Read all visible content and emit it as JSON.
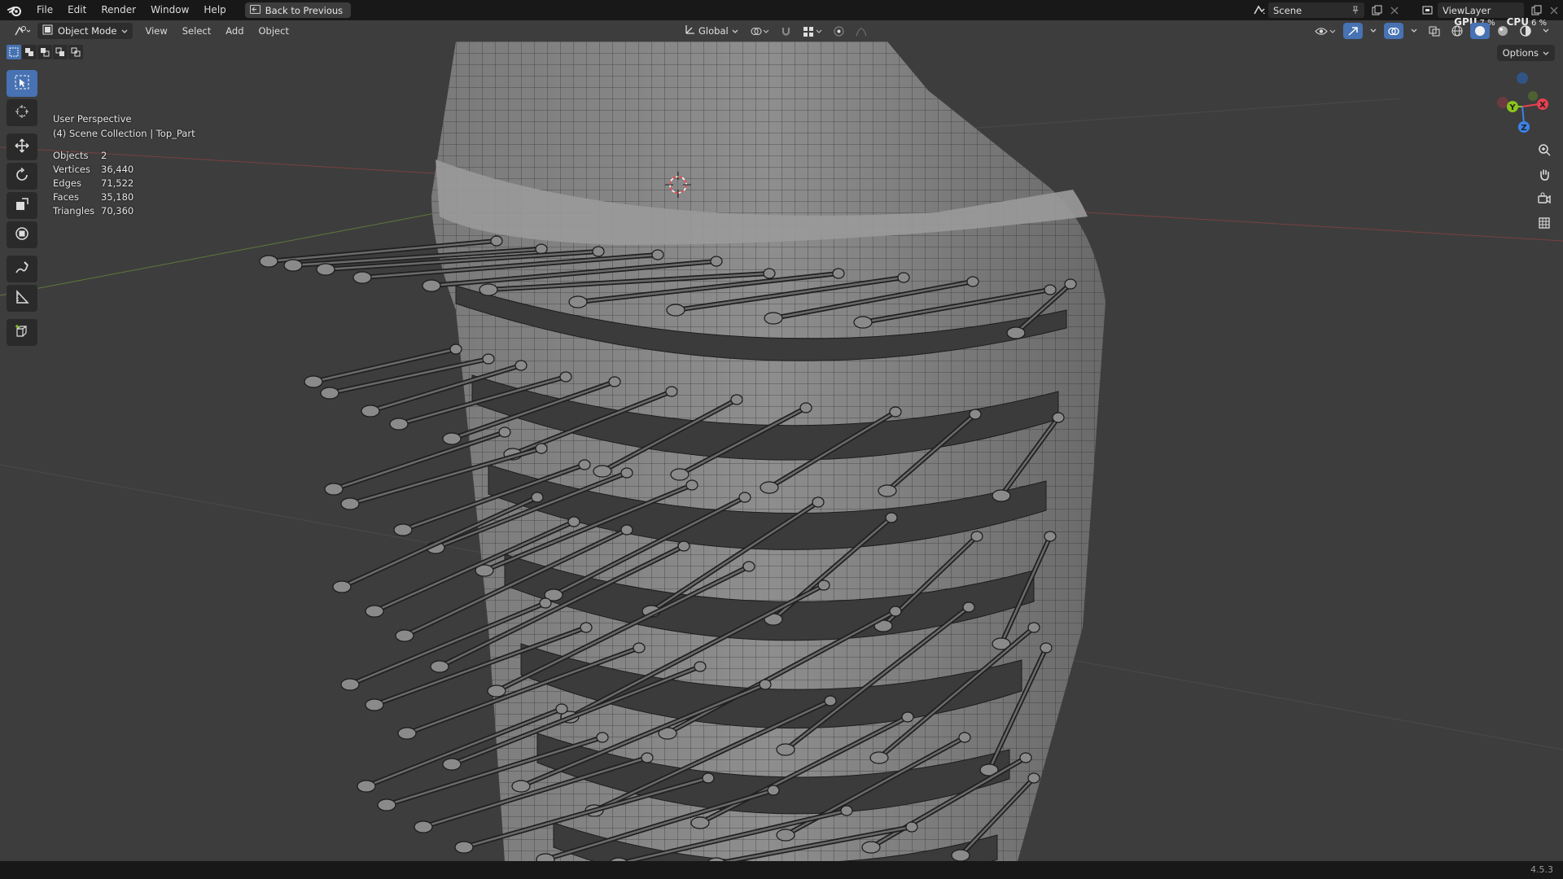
{
  "menu": {
    "items": [
      "File",
      "Edit",
      "Render",
      "Window",
      "Help"
    ],
    "back_button": "Back to Previous"
  },
  "topbar_right": {
    "scene": "Scene",
    "view_layer": "ViewLayer",
    "gpu_label": "GPU",
    "gpu_value": "7 %",
    "cpu_label": "CPU",
    "cpu_value": "6 %"
  },
  "viewport_header": {
    "mode": "Object Mode",
    "menus": [
      "View",
      "Select",
      "Add",
      "Object"
    ],
    "orientation": "Global"
  },
  "options_label": "Options",
  "overlay": {
    "perspective": "User Perspective",
    "collection": "(4) Scene Collection | Top_Part",
    "stats": [
      {
        "label": "Objects",
        "value": "2"
      },
      {
        "label": "Vertices",
        "value": "36,440"
      },
      {
        "label": "Edges",
        "value": "71,522"
      },
      {
        "label": "Faces",
        "value": "35,180"
      },
      {
        "label": "Triangles",
        "value": "70,360"
      }
    ]
  },
  "gizmo": {
    "x": "X",
    "y": "Y",
    "z": "Z"
  },
  "tools": [
    "select-box-icon",
    "cursor-icon",
    "move-icon",
    "rotate-icon",
    "scale-icon",
    "transform-icon",
    "annotate-icon",
    "measure-icon",
    "add-cube-icon"
  ],
  "colors": {
    "accent": "#4772b3",
    "background": "#3d3d3d",
    "topbar": "#181818",
    "x_axis": "#e8404f",
    "y_axis": "#8ac41b",
    "z_axis": "#3b83e7"
  },
  "status": {
    "version": "4.5.3"
  }
}
